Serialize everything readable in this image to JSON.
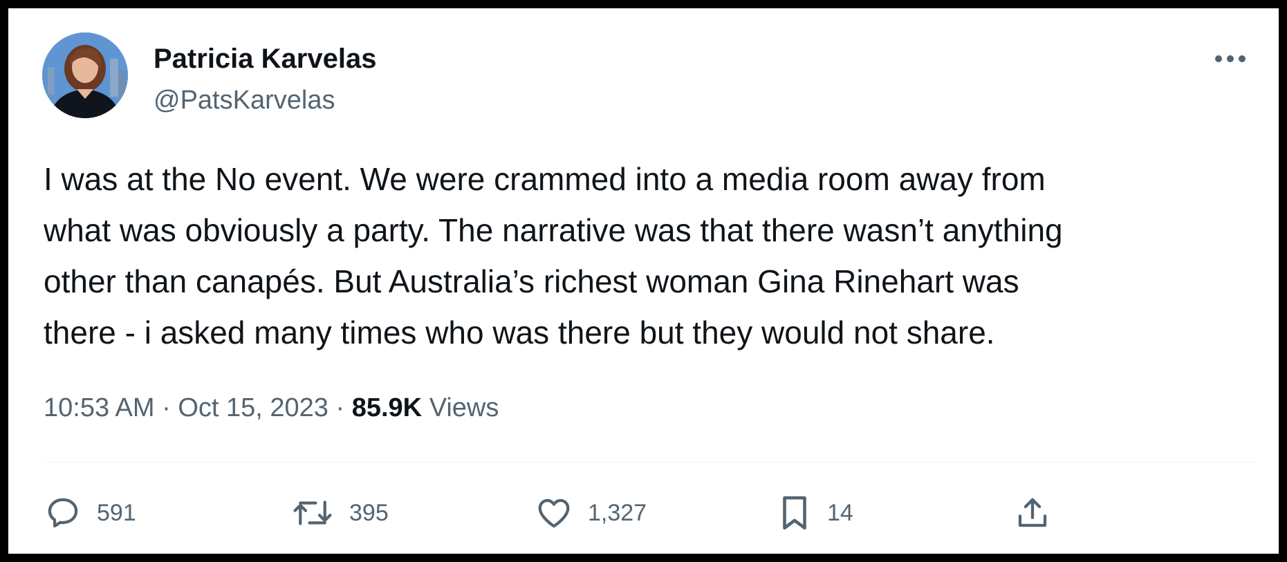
{
  "author": {
    "display_name": "Patricia Karvelas",
    "handle": "@PatsKarvelas"
  },
  "tweet": {
    "lines": [
      "I was at the No event.  We were crammed into a media room away from",
      "what was obviously a party. The narrative was that there wasn’t anything",
      "other than canapés. But Australia’s richest woman Gina Rinehart was",
      "there - i asked many times who was there but they would not share."
    ]
  },
  "meta": {
    "time": "10:53 AM",
    "separator": "·",
    "date": "Oct 15, 2023",
    "views_count": "85.9K",
    "views_label": "Views"
  },
  "actions": {
    "replies": "591",
    "reposts": "395",
    "likes": "1,327",
    "bookmarks": "14"
  },
  "icons": {
    "more": "more-dots-icon",
    "reply": "reply-bubble-icon",
    "repost": "repost-arrows-icon",
    "like": "heart-icon",
    "bookmark": "bookmark-icon",
    "share": "share-upload-icon"
  },
  "colors": {
    "text_primary": "#0f1419",
    "text_secondary": "#536471",
    "divider": "#eff3f4",
    "background": "#ffffff"
  }
}
